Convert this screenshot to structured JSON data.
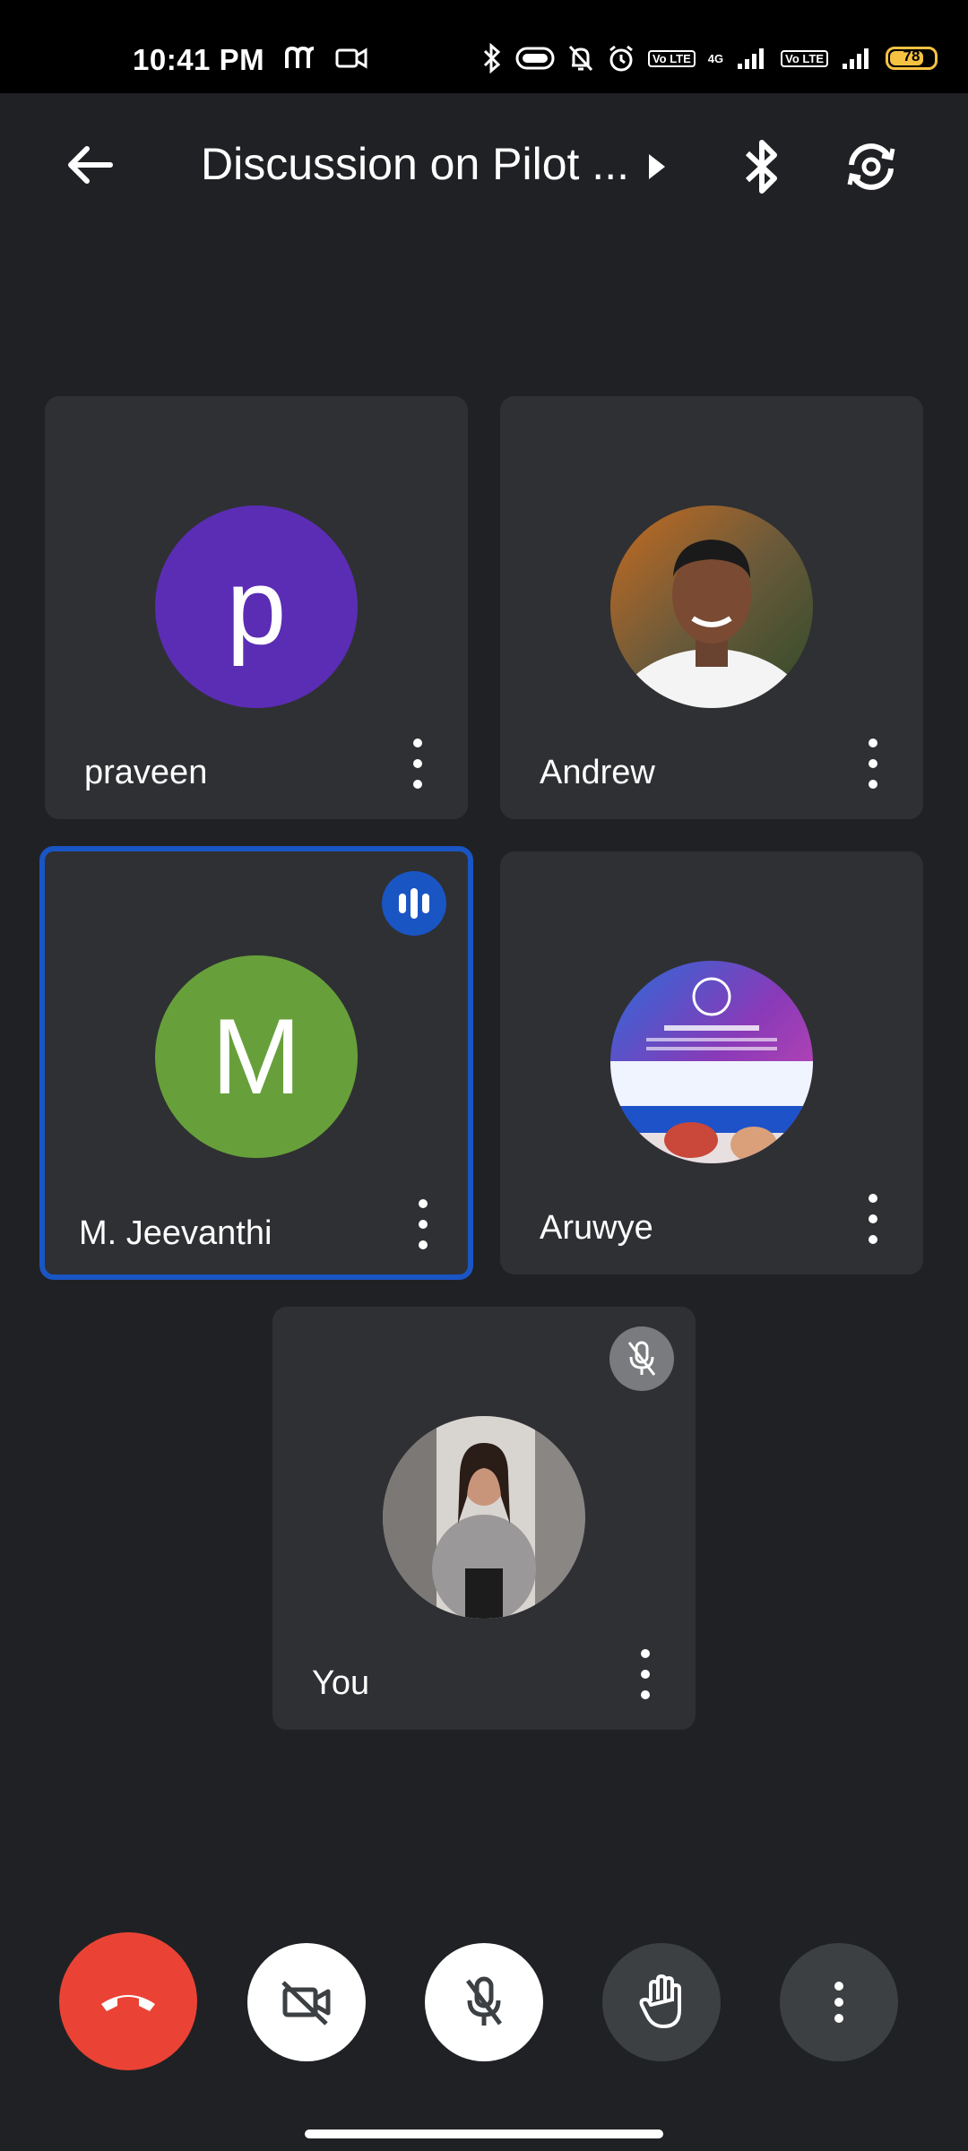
{
  "status_bar": {
    "time": "10:41 PM",
    "battery": "78",
    "network_4g": "4G",
    "volte_1": "Vo LTE",
    "volte_2": "Vo LTE"
  },
  "header": {
    "title": "Discussion on Pilot ..."
  },
  "participants": [
    {
      "name": "praveen",
      "initial": "p",
      "avatar_color": "#5b2db5"
    },
    {
      "name": "Andrew"
    },
    {
      "name": "M. Jeevanthi",
      "initial": "M",
      "avatar_color": "#67a03a",
      "speaking": true
    },
    {
      "name": "Aruwye"
    },
    {
      "name": "You",
      "muted": true
    }
  ],
  "colors": {
    "background": "#202124",
    "tile": "#2f3033",
    "active_border": "#1a55c4",
    "end_call": "#ea4335"
  },
  "icons": {
    "back": "arrow-left-icon",
    "bluetooth": "bluetooth-icon",
    "rotate_camera": "camera-rotate-icon",
    "end_call": "phone-hangup-icon",
    "camera_off": "video-off-icon",
    "mic_off": "mic-off-icon",
    "raise_hand": "hand-icon",
    "more": "more-vert-icon"
  }
}
